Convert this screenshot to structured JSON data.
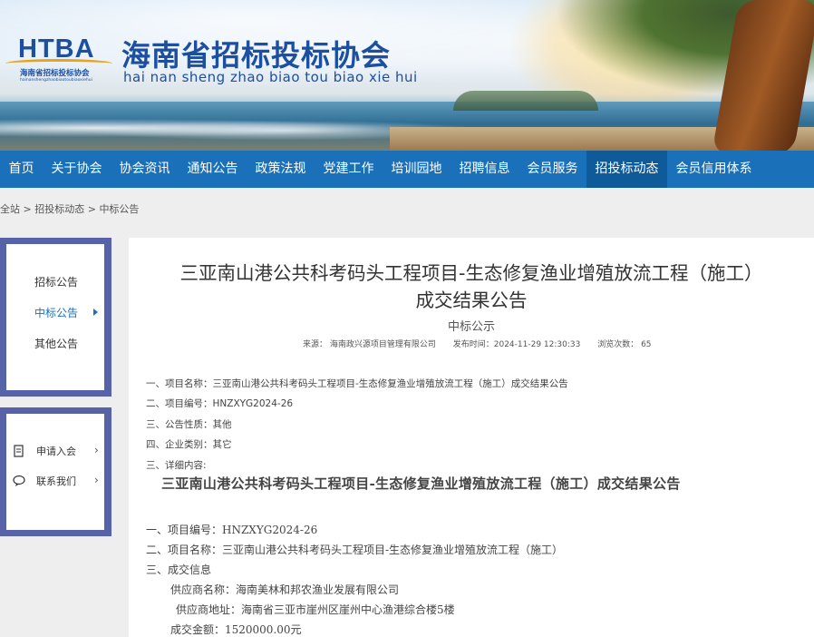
{
  "header": {
    "logo_text": "HTBA",
    "logo_cn": "海南省招标投标协会",
    "logo_en": "hainanshengzhaobiaotoubiaoxiehui",
    "site_title": "海南省招标投标协会",
    "site_pinyin": "hai nan sheng zhao biao tou biao xie hui"
  },
  "nav": {
    "items": [
      "首页",
      "关于协会",
      "协会资讯",
      "通知公告",
      "政策法规",
      "党建工作",
      "培训园地",
      "招聘信息",
      "会员服务",
      "招投标动态",
      "会员信用体系"
    ],
    "active_index": 9
  },
  "breadcrumb": {
    "items": [
      "全站",
      "招投标动态",
      "中标公告"
    ],
    "separator": ">"
  },
  "sidebar": {
    "categories": [
      "招标公告",
      "中标公告",
      "其他公告"
    ],
    "active_index": 1,
    "services": [
      {
        "label": "申请入会",
        "icon": "document-icon"
      },
      {
        "label": "联系我们",
        "icon": "chat-icon"
      }
    ]
  },
  "article": {
    "title_line1": "三亚南山港公共科考码头工程项目-生态修复渔业增殖放流工程（施工）",
    "title_line2": "成交结果公告",
    "subtitle": "中标公示",
    "meta": {
      "source": "来源：  海南政兴源项目管理有限公司",
      "published": "发布时间：2024-11-29 12:30:33",
      "views": "浏览次数：  65"
    },
    "fields": [
      "一、项目名称：三亚南山港公共科考码头工程项目-生态修复渔业增殖放流工程（施工）成交结果公告",
      "二、项目编号：HNZXYG2024-26",
      "三、公告性质：其他",
      "四、企业类别：其它",
      "三、详细内容:"
    ],
    "body_title": "三亚南山港公共科考码头工程项目-生态修复渔业增殖放流工程（施工）成交结果公告",
    "body_lines": [
      "一、项目编号：HNZXYG2024-26",
      "二、项目名称：三亚南山港公共科考码头工程项目-生态修复渔业增殖放流工程（施工）",
      "三、成交信息",
      "供应商名称：海南美林和邦农渔业发展有限公司",
      "供应商地址：海南省三亚市崖州区崖州中心渔港综合楼5楼",
      "成交金额：1520000.00元"
    ]
  },
  "colors": {
    "nav_bg": "#1a71b9",
    "nav_active": "#0f5a99",
    "sidebar_frame": "#5763a8",
    "brand_blue": "#1d4fa0"
  }
}
